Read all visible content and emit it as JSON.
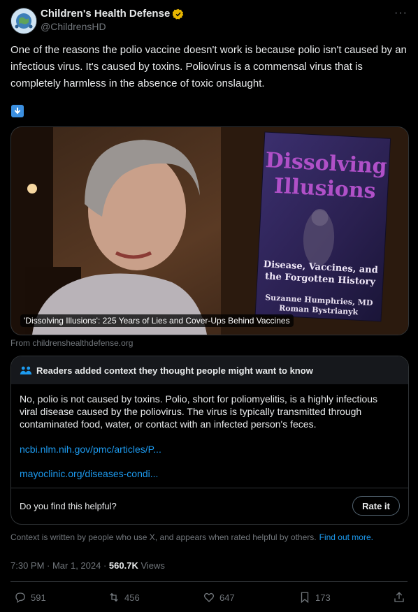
{
  "author": {
    "name": "Children's Health Defense",
    "handle": "@ChildrensHD",
    "avatar_icon": "globe-children-avatar",
    "verified_color": "#e8b600"
  },
  "tweet": {
    "text": "One of the reasons the polio vaccine doesn't work is because polio isn't caused by an infectious virus. It's caused by toxins. Poliovirus is a commensal virus that is completely harmless in the absence of toxic onslaught.",
    "emoji": "down-arrow-emoji"
  },
  "card": {
    "caption": "'Dissolving Illusions': 225 Years of Lies and Cover-Ups Behind Vaccines",
    "source": "From childrenshealthdefense.org",
    "book": {
      "title_line1": "Dissolving",
      "title_line2": "Illusions",
      "subtitle_line1": "Disease, Vaccines, and",
      "subtitle_line2": "the Forgotten History",
      "author1": "Suzanne Humphries, MD",
      "author2": "Roman Bystrianyk"
    }
  },
  "community_note": {
    "header": "Readers added context they thought people might want to know",
    "body": "No, polio is not caused by toxins. Polio, short for poliomyelitis, is a highly infectious viral disease caused by the poliovirus. The virus is typically transmitted through contaminated food, water, or contact with an infected person's feces.",
    "links": [
      "ncbi.nlm.nih.gov/pmc/articles/P...",
      "mayoclinic.org/diseases-condi..."
    ],
    "helpful_prompt": "Do you find this helpful?",
    "rate_button": "Rate it",
    "footer_text": "Context is written by people who use X, and appears when rated helpful by others.",
    "footer_link": "Find out more."
  },
  "meta": {
    "time": "7:30 PM · Mar 1, 2024 · ",
    "views_count": "560.7K",
    "views_label": " Views"
  },
  "actions": {
    "replies": "591",
    "reposts": "456",
    "likes": "647",
    "bookmarks": "173"
  },
  "colors": {
    "accent": "#1d9bf0",
    "background": "#000000",
    "muted": "#71767b"
  }
}
